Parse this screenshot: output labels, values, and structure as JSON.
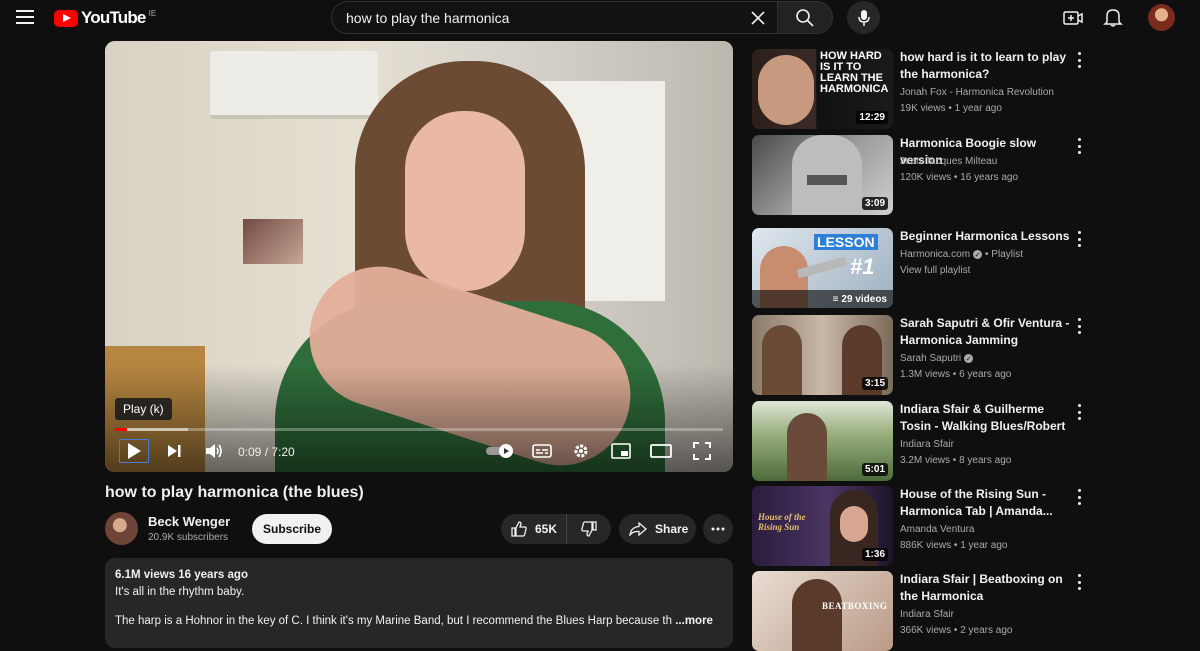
{
  "header": {
    "logo_text": "YouTube",
    "country_code": "IE",
    "search_value": "how to play the harmonica",
    "icons": [
      "menu-icon",
      "clear-icon",
      "search-icon",
      "mic-icon",
      "create-icon",
      "bell-icon",
      "avatar"
    ]
  },
  "player": {
    "tooltip": "Play (k)",
    "time": "0:09 / 7:20",
    "progress_fraction": 0.02,
    "buffer_fraction": 0.12
  },
  "video": {
    "title": "how to play harmonica (the blues)",
    "channel_name": "Beck Wenger",
    "subscribers": "20.9K subscribers",
    "subscribe_label": "Subscribe",
    "likes": "65K",
    "share_label": "Share"
  },
  "description": {
    "meta": "6.1M views  16 years ago",
    "line1": "It's all in the rhythm baby.",
    "line2": "The harp is a Hohnor in the key of C.  I think it's my Marine Band, but I recommend the Blues Harp because th",
    "more_label": "...more"
  },
  "recommendations": [
    {
      "title": "how hard is it to learn to play the harmonica?",
      "channel": "Jonah Fox - Harmonica Revolution",
      "meta": "19K views • 1 year ago",
      "duration": "12:29",
      "thumb_text": "HOW HARD IS IT TO LEARN THE HARMONICA"
    },
    {
      "title": "Harmonica Boogie slow version",
      "channel": "Jean-Jacques Milteau",
      "meta": "120K views • 16 years ago",
      "duration": "3:09"
    },
    {
      "title": "Beginner Harmonica Lessons",
      "channel": "Harmonica.com",
      "channel_suffix": "• Playlist",
      "meta": "View full playlist",
      "duration": "29 videos",
      "thumb_text": "LESSON",
      "thumb_text2": "#1"
    },
    {
      "title": "Sarah Saputri & Ofir Ventura - Harmonica Jamming",
      "channel": "Sarah Saputri",
      "meta": "1.3M views • 6 years ago",
      "duration": "3:15"
    },
    {
      "title": "Indiara Sfair & Guilherme Tosin - Walking Blues/Robert Johnson",
      "channel": "Indiara Sfair",
      "meta": "3.2M views • 8 years ago",
      "duration": "5:01"
    },
    {
      "title": "House of the Rising Sun - Harmonica Tab | Amanda...",
      "channel": "Amanda Ventura",
      "meta": "886K views • 1 year ago",
      "duration": "1:36",
      "thumb_text": "House of the Rising Sun"
    },
    {
      "title": "Indiara Sfair | Beatboxing on the Harmonica",
      "channel": "Indiara Sfair",
      "meta": "366K views • 2 years ago",
      "duration": "",
      "thumb_text": "BEATBOXING"
    }
  ]
}
